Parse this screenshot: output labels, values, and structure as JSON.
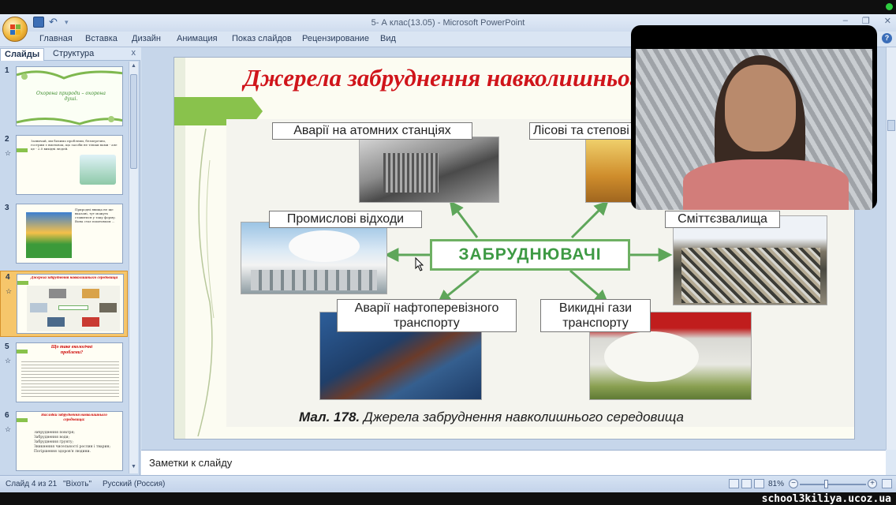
{
  "window": {
    "title": "5- А клас(13.05) - Microsoft PowerPoint"
  },
  "ribbon": {
    "tabs": [
      "Главная",
      "Вставка",
      "Дизайн",
      "Анимация",
      "Показ слайдов",
      "Рецензирование",
      "Вид"
    ]
  },
  "leftpane": {
    "tabs": [
      "Слайды",
      "Структура"
    ],
    "close": "x",
    "slides": [
      {
        "num": "1",
        "text": "Охорона природи – охорона душі."
      },
      {
        "num": "2",
        "text": "Зазвичай, ми бачимо проблеми, безперечно, гострим є висновок, що засоби не тільки вами - але це - 2.0 вихідні людей."
      },
      {
        "num": "3",
        "text": "Природні явища не ще вказані, тут можуть ставитися у таку форму. Вона стає поштовхом ..."
      },
      {
        "num": "4",
        "text": "Джерела забруднення навколишнього середовища"
      },
      {
        "num": "5",
        "text": "Що таке екологічні проблеми?"
      },
      {
        "num": "6",
        "text": "Наслідки забруднення навколишнього середовища:",
        "items": [
          "Забруднення повітря;",
          "Забруднення води;",
          "Забруднення ґрунту;",
          "Зникнення чисельності рослин і тварин;",
          "Погіршення здоров'я людини."
        ]
      }
    ]
  },
  "slide": {
    "title": "Джерела забруднення навколишнього середовища",
    "labels": {
      "nuclear": "Аварії на атомних станціях",
      "forest": "Лісові та степові пожежі",
      "industrial": "Промислові відходи",
      "landfill": "Сміттєзвалища",
      "oil": "Аварії нафтоперевізного транспорту",
      "exhaust": "Викидні гази транспорту"
    },
    "center": "ЗАБРУДНЮВАЧІ",
    "caption_bold": "Мал. 178.",
    "caption_text": " Джерела забруднення навколишнього середовища"
  },
  "notes": {
    "placeholder": "Заметки к слайду"
  },
  "status": {
    "slide_info": "Слайд 4 из 21",
    "theme": "\"Віхоть\"",
    "language": "Русский (Россия)",
    "zoom": "81%"
  },
  "overlay": {
    "watermark": "school3kiliya.ucoz.ua"
  },
  "colors": {
    "title_red": "#d0151b",
    "accent_green": "#89c24c",
    "arrow_green": "#5ea65a"
  }
}
